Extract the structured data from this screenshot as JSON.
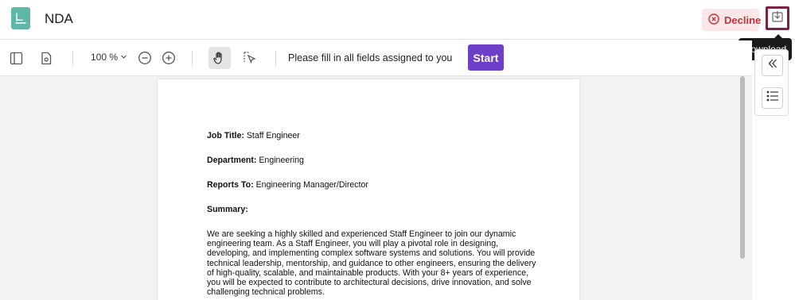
{
  "header": {
    "title": "NDA",
    "decline_label": "Decline",
    "download_tooltip": "Download"
  },
  "toolbar": {
    "zoom": "100 %",
    "instruction": "Please fill in all fields assigned to you",
    "start_label": "Start"
  },
  "document": {
    "job_title_label": "Job Title:",
    "job_title_value": "Staff Engineer",
    "department_label": "Department:",
    "department_value": "Engineering",
    "reports_to_label": "Reports To:",
    "reports_to_value": "Engineering Manager/Director",
    "summary_label": "Summary:",
    "summary_lines": [
      "We are seeking a highly skilled and experienced Staff Engineer to join our dynamic",
      "engineering team. As a Staff Engineer, you will play a pivotal role in designing,",
      "developing, and implementing complex software systems and solutions. You will provide",
      "technical leadership, mentorship, and guidance to other engineers, ensuring the delivery",
      "of high-quality, scalable, and maintainable products. With your 8+ years of experience,",
      "you will be expected to contribute to architectural decisions, drive innovation, and solve",
      "challenging technical problems."
    ]
  },
  "colors": {
    "accent": "#6b3fc8",
    "decline": "#c8313f",
    "doc_icon": "#5fb7aa",
    "highlight_border": "#7a2346"
  },
  "icons": [
    "document-icon",
    "x-circle-icon",
    "download-icon",
    "sidebar-toggle-icon",
    "page-settings-icon",
    "chevron-down-icon",
    "zoom-out-icon",
    "zoom-in-icon",
    "hand-icon",
    "select-pointer-icon",
    "collapse-left-icon",
    "list-icon"
  ]
}
